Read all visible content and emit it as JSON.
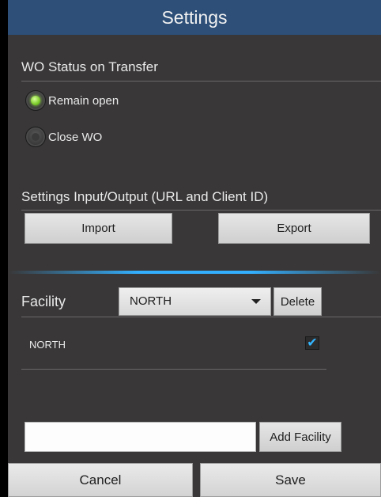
{
  "title": "Settings",
  "wo_status": {
    "label": "WO Status on Transfer",
    "options": [
      {
        "label": "Remain open",
        "selected": true
      },
      {
        "label": "Close WO",
        "selected": false
      }
    ]
  },
  "io": {
    "label": "Settings Input/Output (URL and Client ID)",
    "import_label": "Import",
    "export_label": "Export"
  },
  "facility": {
    "label": "Facility",
    "selected": "NORTH",
    "delete_label": "Delete",
    "items": [
      {
        "name": "NORTH",
        "checked": true
      }
    ],
    "new_facility_value": "",
    "add_label": "Add Facility"
  },
  "footer": {
    "cancel_label": "Cancel",
    "save_label": "Save"
  },
  "colors": {
    "title_bar": "#2d4f78",
    "background": "#393737",
    "accent": "#33b5ff",
    "radio_selected": "#7ccc2a"
  }
}
